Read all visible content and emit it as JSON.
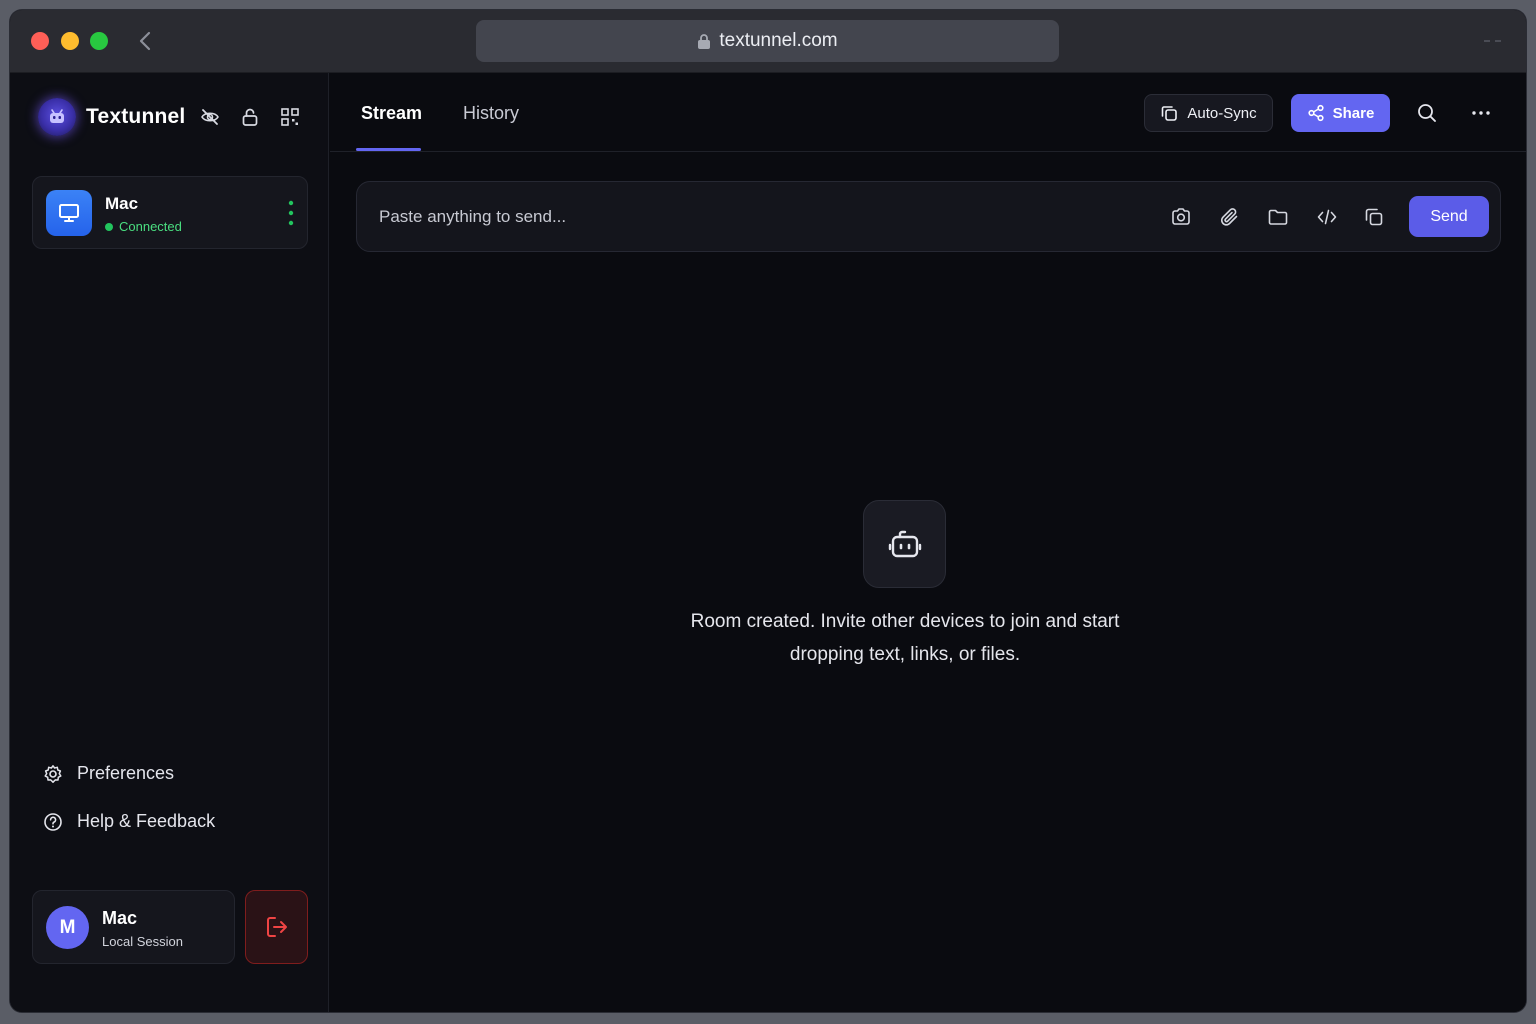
{
  "browser": {
    "url": "textunnel.com"
  },
  "sidebar": {
    "brand_name": "Textunnel",
    "device": {
      "name": "Mac",
      "status": "Connected"
    },
    "links": [
      {
        "label": "Preferences",
        "icon": "gear-icon"
      },
      {
        "label": "Help & Feedback",
        "icon": "help-circle-icon"
      }
    ],
    "user": {
      "initial": "M",
      "name": "Mac",
      "subtitle": "Local Session"
    }
  },
  "header": {
    "tabs": [
      {
        "label": "Stream",
        "active": true
      },
      {
        "label": "History",
        "active": false
      }
    ],
    "auto_sync_label": "Auto-Sync",
    "share_label": "Share"
  },
  "composer": {
    "placeholder": "Paste anything to send...",
    "send_label": "Send"
  },
  "empty_state": {
    "line1": "Room created. Invite other devices to join and start",
    "line2": "dropping text, links, or files."
  },
  "colors": {
    "accent": "#6366f1",
    "connected": "#22c55e",
    "danger": "#ef4444"
  }
}
